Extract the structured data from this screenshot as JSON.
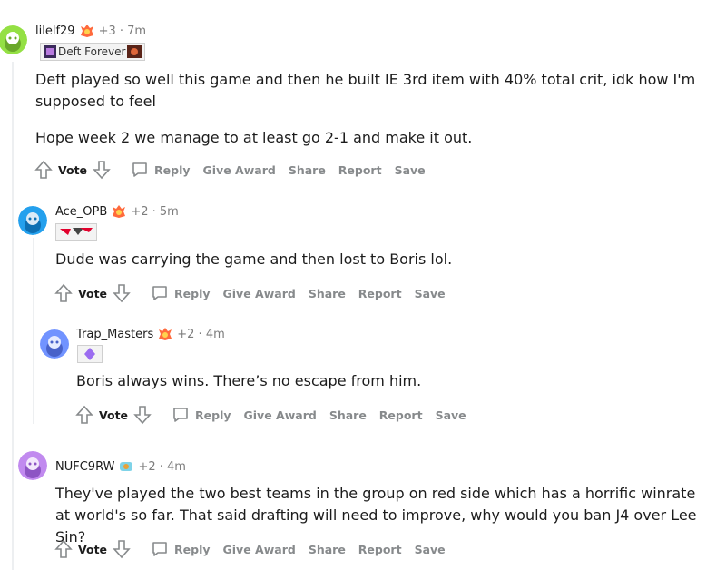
{
  "comments": [
    {
      "username": "lilelf29",
      "karma": "+3 · 7m",
      "flair": "Deft Forever",
      "paragraphs": [
        "Deft played so well this game and then he built IE 3rd item with 40% total crit, idk how I'm supposed to feel",
        "Hope week 2 we manage to at least go 2-1 and make it out."
      ],
      "avatar_color": "#94e044"
    },
    {
      "username": "Ace_OPB",
      "karma": "+2 · 5m",
      "flair": "",
      "paragraphs": [
        "Dude was carrying the game and then lost to Boris lol."
      ],
      "avatar_color": "#24a0ed"
    },
    {
      "username": "Trap_Masters",
      "karma": "+2 · 4m",
      "flair": "",
      "paragraphs": [
        "Boris always wins. There’s no escape from him."
      ],
      "avatar_color": "#7193ff"
    },
    {
      "username": "NUFC9RW",
      "karma": "+2 · 4m",
      "flair": "",
      "paragraphs": [
        "They've played the two best teams in the group on red side which has a horrific winrate at world's so far. That said drafting will need to improve, why would you ban J4 over Lee Sin?"
      ],
      "avatar_color": "#c18aef"
    }
  ],
  "actions": {
    "vote": "Vote",
    "reply": "Reply",
    "give_award": "Give Award",
    "share": "Share",
    "report": "Report",
    "save": "Save"
  },
  "colors": {
    "muted": "#878a8c",
    "text": "#1c1c1c",
    "thread_line": "#edeff1"
  }
}
